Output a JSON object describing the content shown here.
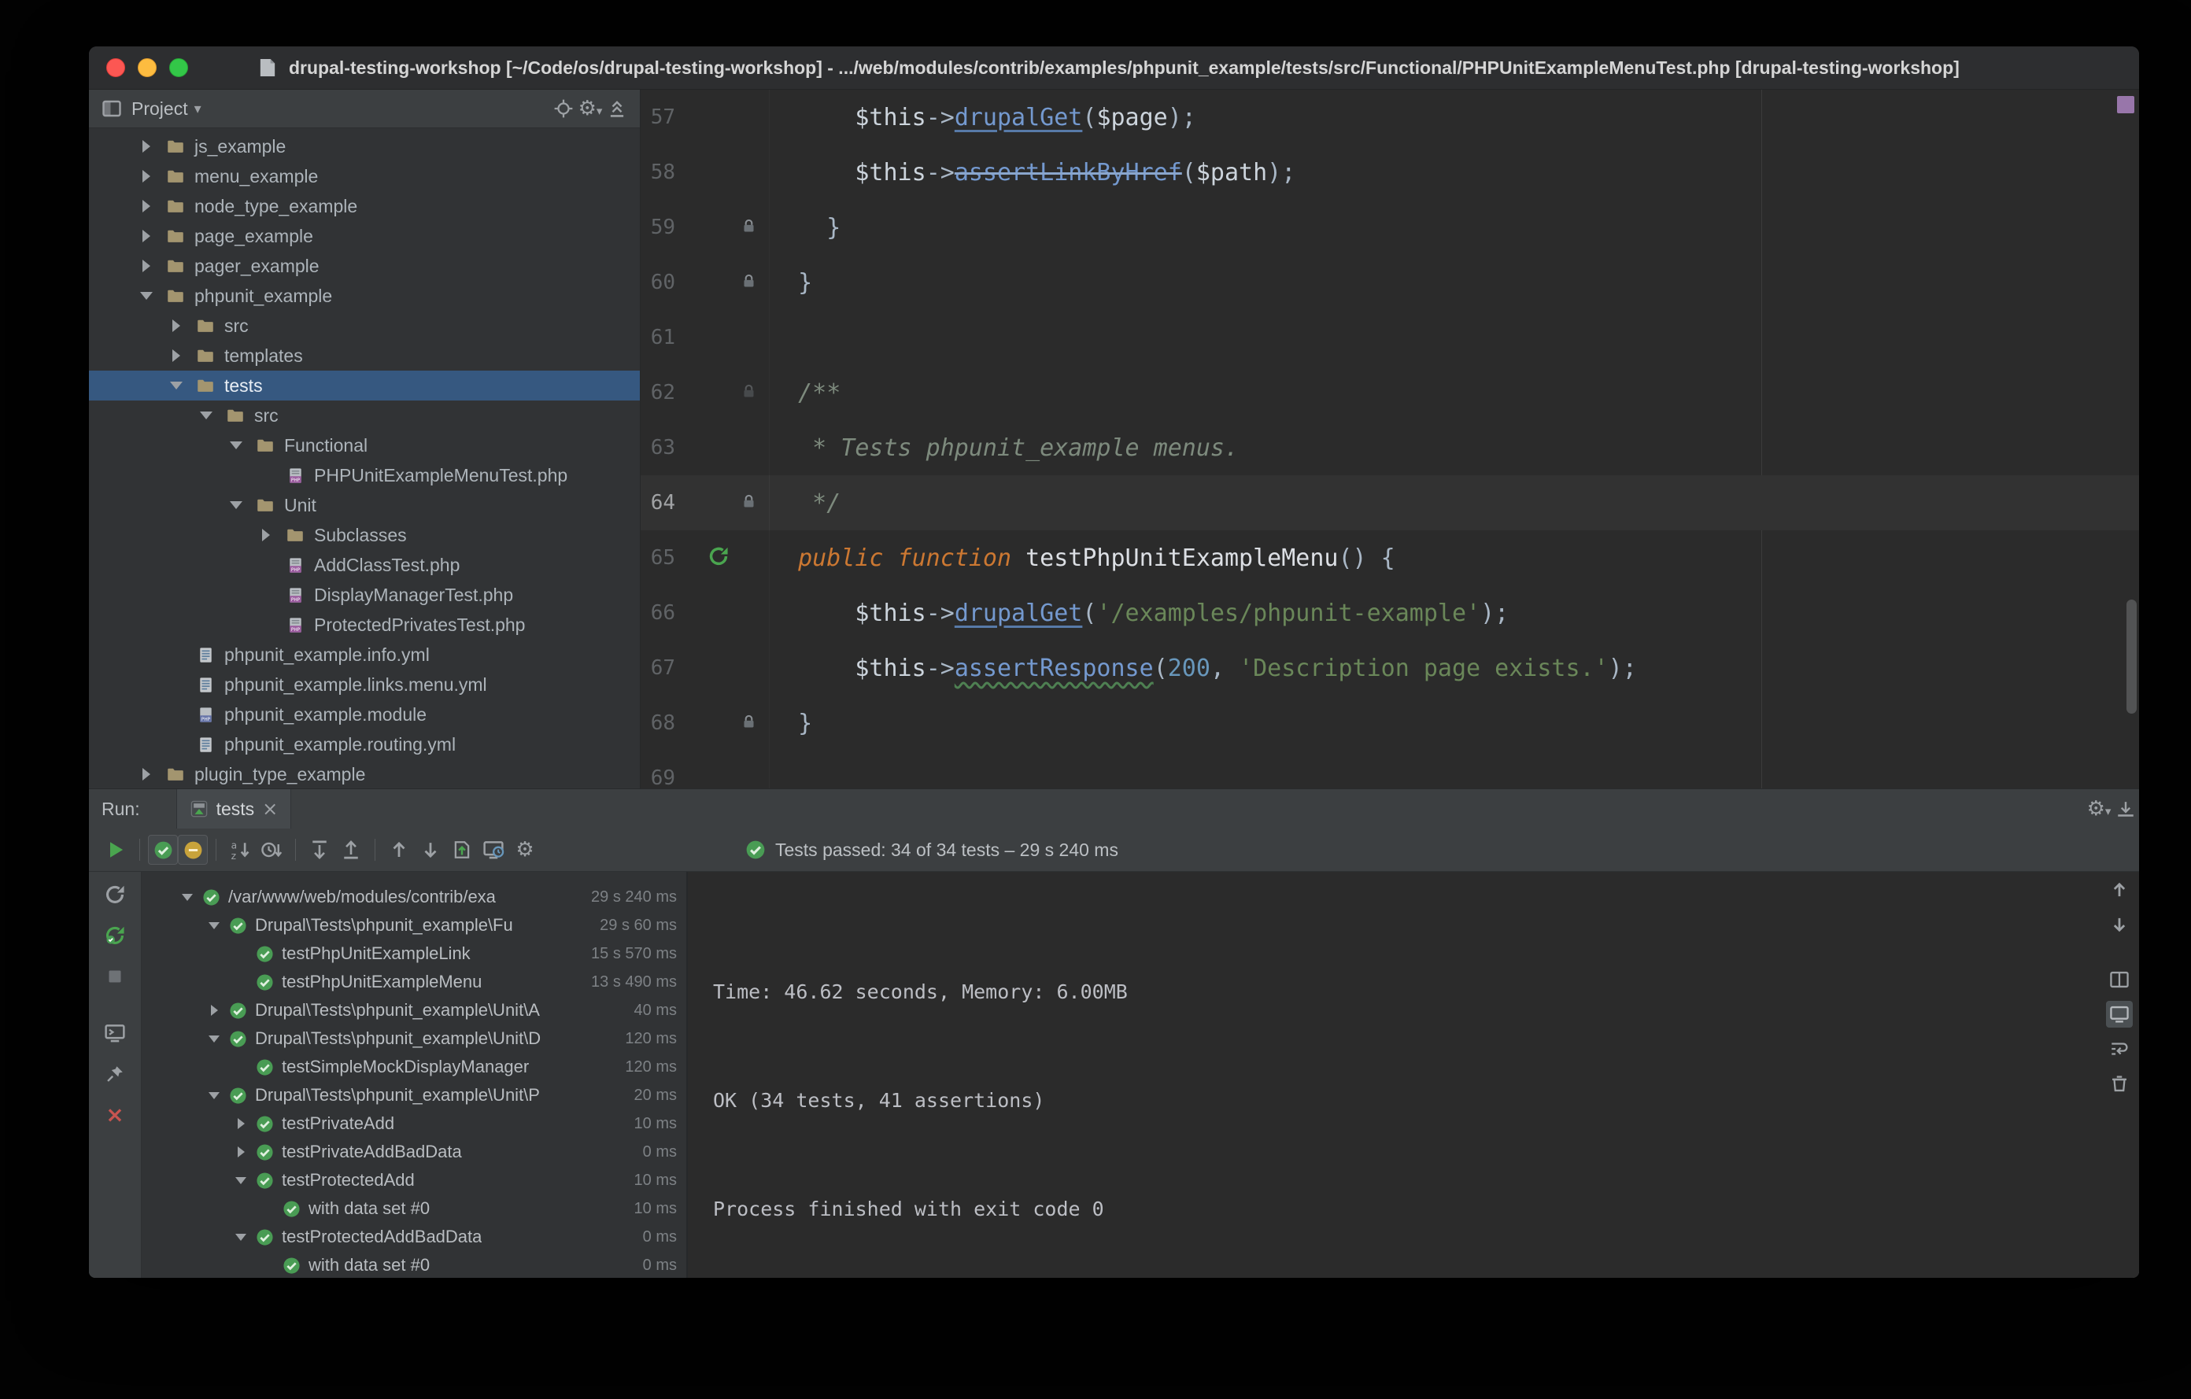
{
  "titlebar": {
    "title": "drupal-testing-workshop [~/Code/os/drupal-testing-workshop] - .../web/modules/contrib/examples/phpunit_example/tests/src/Functional/PHPUnitExampleMenuTest.php [drupal-testing-workshop]"
  },
  "colors": {
    "selection_blue": "#365880",
    "test_pass_green": "#499C54",
    "run_green": "#4AA54F",
    "close_red": "#C75450",
    "error_stripe_purple": "#9876AA"
  },
  "project_panel": {
    "title": "Project",
    "header_icons": [
      "locate-file-icon",
      "project-settings-icon",
      "collapse-panel-icon"
    ],
    "tree": [
      {
        "label": "js_example",
        "indent": 0,
        "arrow": "right",
        "icon": "folder"
      },
      {
        "label": "menu_example",
        "indent": 0,
        "arrow": "right",
        "icon": "folder"
      },
      {
        "label": "node_type_example",
        "indent": 0,
        "arrow": "right",
        "icon": "folder"
      },
      {
        "label": "page_example",
        "indent": 0,
        "arrow": "right",
        "icon": "folder"
      },
      {
        "label": "pager_example",
        "indent": 0,
        "arrow": "right",
        "icon": "folder"
      },
      {
        "label": "phpunit_example",
        "indent": 0,
        "arrow": "down",
        "icon": "folder"
      },
      {
        "label": "src",
        "indent": 1,
        "arrow": "right",
        "icon": "folder"
      },
      {
        "label": "templates",
        "indent": 1,
        "arrow": "right",
        "icon": "folder"
      },
      {
        "label": "tests",
        "indent": 1,
        "arrow": "down",
        "icon": "folder",
        "selected": true
      },
      {
        "label": "src",
        "indent": 2,
        "arrow": "down",
        "icon": "folder"
      },
      {
        "label": "Functional",
        "indent": 3,
        "arrow": "down",
        "icon": "folder"
      },
      {
        "label": "PHPUnitExampleMenuTest.php",
        "indent": 4,
        "arrow": "none",
        "icon": "php-test"
      },
      {
        "label": "Unit",
        "indent": 3,
        "arrow": "down",
        "icon": "folder"
      },
      {
        "label": "Subclasses",
        "indent": 4,
        "arrow": "right",
        "icon": "folder"
      },
      {
        "label": "AddClassTest.php",
        "indent": 4,
        "arrow": "none",
        "icon": "php-test"
      },
      {
        "label": "DisplayManagerTest.php",
        "indent": 4,
        "arrow": "none",
        "icon": "php-test"
      },
      {
        "label": "ProtectedPrivatesTest.php",
        "indent": 4,
        "arrow": "none",
        "icon": "php-test"
      },
      {
        "label": "phpunit_example.info.yml",
        "indent": 1,
        "arrow": "none",
        "icon": "yml"
      },
      {
        "label": "phpunit_example.links.menu.yml",
        "indent": 1,
        "arrow": "none",
        "icon": "yml"
      },
      {
        "label": "phpunit_example.module",
        "indent": 1,
        "arrow": "none",
        "icon": "php-file"
      },
      {
        "label": "phpunit_example.routing.yml",
        "indent": 1,
        "arrow": "none",
        "icon": "yml"
      },
      {
        "label": "plugin_type_example",
        "indent": 0,
        "arrow": "right",
        "icon": "folder"
      }
    ]
  },
  "editor": {
    "lines": [
      {
        "num": "57",
        "gutter": "none",
        "tokens": [
          [
            "p",
            "      "
          ],
          [
            "v",
            "$this"
          ],
          [
            "p",
            "->"
          ],
          [
            "m",
            "drupalGet"
          ],
          [
            "p",
            "("
          ],
          [
            "v",
            "$page"
          ],
          [
            "p",
            ");"
          ]
        ]
      },
      {
        "num": "58",
        "gutter": "none",
        "tokens": [
          [
            "p",
            "      "
          ],
          [
            "v",
            "$this"
          ],
          [
            "p",
            "->"
          ],
          [
            "ms",
            "assertLinkByHref"
          ],
          [
            "p",
            "("
          ],
          [
            "v",
            "$path"
          ],
          [
            "p",
            ");"
          ]
        ]
      },
      {
        "num": "59",
        "gutter": "lock",
        "tokens": [
          [
            "p",
            "    }"
          ]
        ]
      },
      {
        "num": "60",
        "gutter": "lock",
        "tokens": [
          [
            "p",
            "  }"
          ]
        ]
      },
      {
        "num": "61",
        "gutter": "none",
        "tokens": []
      },
      {
        "num": "62",
        "gutter": "lock-faint",
        "tokens": [
          [
            "c",
            "  /**"
          ]
        ]
      },
      {
        "num": "63",
        "gutter": "none",
        "tokens": [
          [
            "c",
            "   * Tests phpunit_example menus."
          ]
        ]
      },
      {
        "num": "64",
        "gutter": "lock",
        "hl": true,
        "tokens": [
          [
            "c",
            "   */"
          ]
        ]
      },
      {
        "num": "65",
        "gutter": "run",
        "tokens": [
          [
            "k",
            "  public function "
          ],
          [
            "f",
            "testPhpUnitExampleMenu"
          ],
          [
            "p",
            "() {"
          ]
        ]
      },
      {
        "num": "66",
        "gutter": "none",
        "tokens": [
          [
            "p",
            "      "
          ],
          [
            "v",
            "$this"
          ],
          [
            "p",
            "->"
          ],
          [
            "m",
            "drupalGet"
          ],
          [
            "p",
            "("
          ],
          [
            "s",
            "'/examples/phpunit-example'"
          ],
          [
            "p",
            ");"
          ]
        ]
      },
      {
        "num": "67",
        "gutter": "none",
        "tokens": [
          [
            "p",
            "      "
          ],
          [
            "v",
            "$this"
          ],
          [
            "p",
            "->"
          ],
          [
            "mw",
            "assertResponse"
          ],
          [
            "p",
            "("
          ],
          [
            "n",
            "200"
          ],
          [
            "p",
            ", "
          ],
          [
            "s",
            "'Description page exists.'"
          ],
          [
            "p",
            ");"
          ]
        ]
      },
      {
        "num": "68",
        "gutter": "lock",
        "tokens": [
          [
            "p",
            "  }"
          ]
        ]
      },
      {
        "num": "69",
        "gutter": "none",
        "tokens": []
      }
    ]
  },
  "run_panel": {
    "run_label": "Run:",
    "tab_label": "tests",
    "status": "Tests passed: 34 of 34 tests – 29 s 240 ms",
    "toolbar_icons": [
      "play-icon",
      "sep",
      "show-passed-icon",
      "show-ignored-icon",
      "sep",
      "sort-alphabetically-icon",
      "sort-by-duration-icon",
      "sep",
      "expand-all-icon",
      "collapse-all-icon",
      "sep",
      "up-arrow-icon",
      "down-arrow-icon",
      "import-test-results-icon",
      "test-history-icon",
      "toolbar-settings-icon"
    ],
    "header_icons": [
      "run-settings-icon",
      "hide-panel-icon"
    ],
    "left_toolbar_icons": [
      "rerun-icon",
      "rerun-failed-icon",
      "stop-icon",
      "console-icon",
      "pin-icon",
      "close-icon"
    ],
    "right_toolbar_icons": [
      "scroll-up-icon",
      "scroll-down-icon",
      "split-icon",
      "preview-icon",
      "soft-wrap-icon",
      "clear-all-icon"
    ],
    "tests": [
      {
        "label": "/var/www/web/modules/contrib/exa",
        "duration": "29 s 240 ms",
        "indent": 0,
        "arrow": "down"
      },
      {
        "label": "Drupal\\Tests\\phpunit_example\\Fu",
        "duration": "29 s 60 ms",
        "indent": 1,
        "arrow": "down"
      },
      {
        "label": "testPhpUnitExampleLink",
        "duration": "15 s 570 ms",
        "indent": 2,
        "arrow": "none"
      },
      {
        "label": "testPhpUnitExampleMenu",
        "duration": "13 s 490 ms",
        "indent": 2,
        "arrow": "none"
      },
      {
        "label": "Drupal\\Tests\\phpunit_example\\Unit\\A",
        "duration": "40 ms",
        "indent": 1,
        "arrow": "right"
      },
      {
        "label": "Drupal\\Tests\\phpunit_example\\Unit\\D",
        "duration": "120 ms",
        "indent": 1,
        "arrow": "down"
      },
      {
        "label": "testSimpleMockDisplayManager",
        "duration": "120 ms",
        "indent": 2,
        "arrow": "none"
      },
      {
        "label": "Drupal\\Tests\\phpunit_example\\Unit\\P",
        "duration": "20 ms",
        "indent": 1,
        "arrow": "down"
      },
      {
        "label": "testPrivateAdd",
        "duration": "10 ms",
        "indent": 2,
        "arrow": "right"
      },
      {
        "label": "testPrivateAddBadData",
        "duration": "0 ms",
        "indent": 2,
        "arrow": "right"
      },
      {
        "label": "testProtectedAdd",
        "duration": "10 ms",
        "indent": 2,
        "arrow": "down"
      },
      {
        "label": "with data set #0",
        "duration": "10 ms",
        "indent": 3,
        "arrow": "none"
      },
      {
        "label": "testProtectedAddBadData",
        "duration": "0 ms",
        "indent": 2,
        "arrow": "down"
      },
      {
        "label": "with data set #0",
        "duration": "0 ms",
        "indent": 3,
        "arrow": "none"
      }
    ],
    "console_lines": [
      "",
      "",
      "Time: 46.62 seconds, Memory: 6.00MB",
      "",
      "",
      "OK (34 tests, 41 assertions)",
      "",
      "",
      "Process finished with exit code 0"
    ]
  }
}
